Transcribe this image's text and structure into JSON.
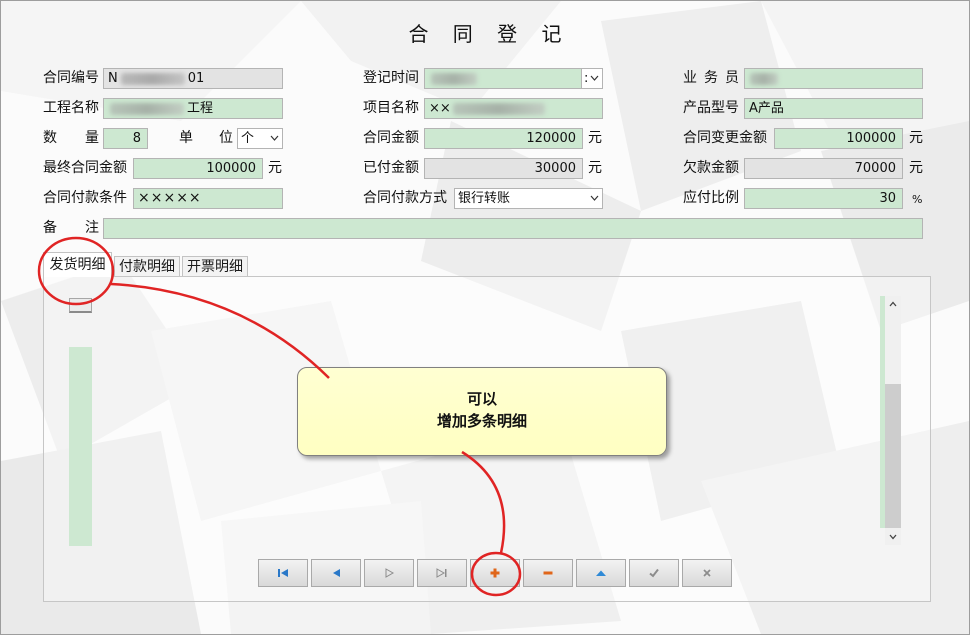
{
  "window": {
    "title": "合 同 登 记"
  },
  "form": {
    "contract_no": {
      "label": "合同编号",
      "prefix": "N",
      "suffix": "01"
    },
    "register_time": {
      "label": "登记时间",
      "picker_text": ":"
    },
    "salesperson": {
      "label": "业 务 员"
    },
    "project_name": {
      "label": "工程名称",
      "suffix": "工程"
    },
    "item_name": {
      "label": "项目名称",
      "prefix": "××"
    },
    "product_model": {
      "label": "产品型号",
      "value": "A产品"
    },
    "quantity": {
      "label": "数 量",
      "value": "8"
    },
    "unit": {
      "label": "单 位",
      "value": "个"
    },
    "contract_amount": {
      "label": "合同金额",
      "value": "120000",
      "unit": "元"
    },
    "changed_amount": {
      "label": "合同变更金额",
      "value": "100000",
      "unit": "元"
    },
    "final_amount": {
      "label": "最终合同金额",
      "value": "100000",
      "unit": "元"
    },
    "paid_amount": {
      "label": "已付金额",
      "value": "30000",
      "unit": "元"
    },
    "owed_amount": {
      "label": "欠款金额",
      "value": "70000",
      "unit": "元"
    },
    "payment_terms": {
      "label": "合同付款条件",
      "value": "×××××"
    },
    "payment_method": {
      "label": "合同付款方式",
      "value": "银行转账"
    },
    "payable_ratio": {
      "label": "应付比例",
      "value": "30",
      "unit": "%"
    },
    "remarks": {
      "label": "备 注"
    }
  },
  "tabs": [
    {
      "label": "发货明细",
      "active": true
    },
    {
      "label": "付款明细",
      "active": false
    },
    {
      "label": "开票明细",
      "active": false
    }
  ],
  "navigator": {
    "first": "first-record-icon",
    "prior": "prior-record-icon",
    "next": "next-record-icon",
    "last": "last-record-icon",
    "insert": "plus-icon",
    "delete": "minus-icon",
    "edit": "triangle-up-icon",
    "post": "check-icon",
    "cancel": "close-icon"
  },
  "callout": {
    "line1": "可以",
    "line2": "增加多条明细"
  },
  "colors": {
    "editable_field": "#cde8d1",
    "readonly_field": "#e3e3e3",
    "callout_fill": "#ffffc2",
    "annotation_red": "#e02424",
    "nav_blue": "#2a78c8",
    "nav_orange": "#e0661a",
    "nav_disabled": "#8c8c8c"
  }
}
